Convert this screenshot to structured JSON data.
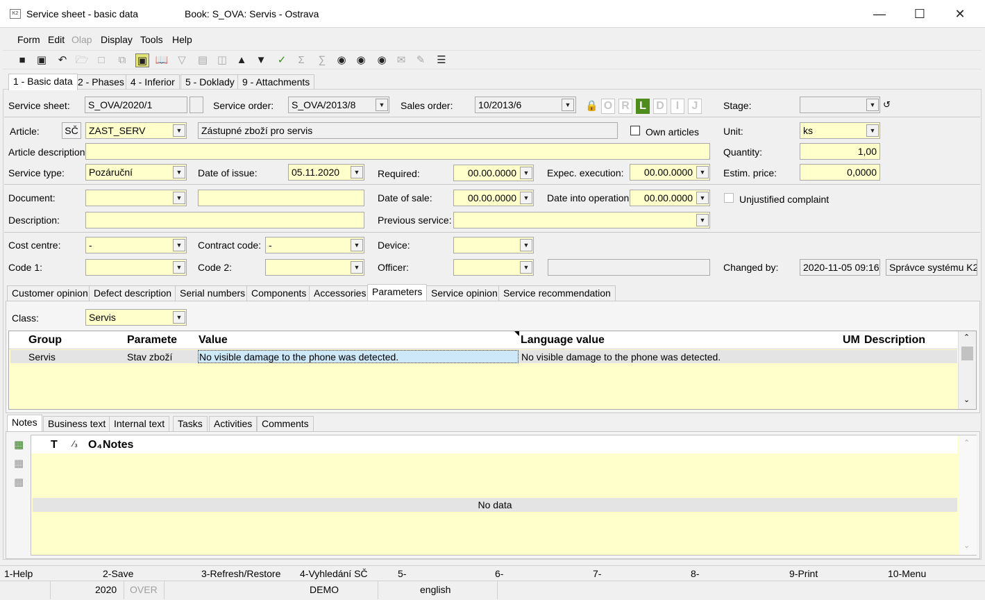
{
  "window": {
    "title": "Service sheet - basic data",
    "book_title": "Book: S_OVA: Servis - Ostrava",
    "app_icon_text": "K2",
    "minimize_glyph": "—",
    "maximize_glyph": "☐",
    "close_glyph": "✕"
  },
  "menu": [
    {
      "label": "Form",
      "enabled": true
    },
    {
      "label": "Edit",
      "enabled": true
    },
    {
      "label": "Olap",
      "enabled": false
    },
    {
      "label": "Display",
      "enabled": true
    },
    {
      "label": "Tools",
      "enabled": true
    },
    {
      "label": "Help",
      "enabled": true
    }
  ],
  "toolbar_icons": [
    "save-icon",
    "save-close-icon",
    "undo-icon",
    "open-folder-icon",
    "new-document-icon",
    "copy-icon",
    "lock-icon",
    "book-icon",
    "filter-icon",
    "filter-list-icon",
    "stack-icon",
    "arrow-up-icon",
    "arrow-down-icon",
    "check-edit-icon",
    "sum-icon",
    "batch-icon",
    "binoculars-icon",
    "binoculars-plus-icon",
    "binoculars-wave-icon",
    "mail-icon",
    "edit-note-icon",
    "hamburger-menu-icon"
  ],
  "main_tabs": [
    "1 - Basic data",
    "2 - Phases",
    "4 - Inferior",
    "5 - Doklady",
    "9 - Attachments"
  ],
  "form": {
    "service_sheet_label": "Service sheet:",
    "service_sheet_value": "S_OVA/2020/1",
    "service_order_label": "Service order:",
    "service_order_value": "S_OVA/2013/8",
    "sales_order_label": "Sales order:",
    "sales_order_value": "10/2013/6",
    "status_letters": [
      "O",
      "R",
      "L",
      "D",
      "I",
      "J"
    ],
    "status_active": "L",
    "stage_label": "Stage:",
    "stage_value": "",
    "article_label": "Article:",
    "article_sc": "SČ",
    "article_value": "ZAST_SERV",
    "article_name": "Zástupné zboží pro servis",
    "own_articles_label": "Own articles",
    "unit_label": "Unit:",
    "unit_value": "ks",
    "article_desc_label": "Article description:",
    "article_desc_value": "",
    "quantity_label": "Quantity:",
    "quantity_value": "1,00",
    "service_type_label": "Service type:",
    "service_type_value": "Pozáruční",
    "date_issue_label": "Date of issue:",
    "date_issue_value": "05.11.2020",
    "required_label": "Required:",
    "required_value": "00.00.0000",
    "expec_exec_label": "Expec. execution:",
    "expec_exec_value": "00.00.0000",
    "estim_price_label": "Estim. price:",
    "estim_price_value": "0,0000",
    "document_label": "Document:",
    "document_value": "",
    "document_text": "",
    "date_sale_label": "Date of sale:",
    "date_sale_value": "00.00.0000",
    "date_operation_label": "Date into operation",
    "date_operation_value": "00.00.0000",
    "unjustified_label": "Unjustified complaint",
    "description_label": "Description:",
    "description_value": "",
    "previous_service_label": "Previous service:",
    "previous_service_value": "",
    "cost_centre_label": "Cost centre:",
    "cost_centre_value": "-",
    "contract_code_label": "Contract code:",
    "contract_code_value": "-",
    "device_label": "Device:",
    "device_value": "",
    "code1_label": "Code 1:",
    "code1_value": "",
    "code2_label": "Code 2:",
    "code2_value": "",
    "officer_label": "Officer:",
    "officer_value": "",
    "officer_text": "",
    "changed_by_label": "Changed by:",
    "changed_by_date": "2020-11-05 09:16",
    "changed_by_user": "Správce systému K2"
  },
  "sub_tabs": [
    "Customer opinion",
    "Defect description",
    "Serial numbers",
    "Components",
    "Accessories",
    "Parameters",
    "Service opinion",
    "Service recommendation"
  ],
  "sub_tab_active": "Parameters",
  "parameters": {
    "class_label": "Class:",
    "class_value": "Servis",
    "columns": [
      "Group",
      "Paramete",
      "Value",
      "Language value",
      "UM",
      "Description"
    ],
    "rows": [
      {
        "group": "Servis",
        "parameter": "Stav zboží",
        "value": "No visible damage to the phone was detected.",
        "language_value": "No visible damage to the phone was detected.",
        "um": "",
        "description": ""
      }
    ]
  },
  "notes_tabs": [
    "Notes",
    "Business text",
    "Internal text",
    "Tasks",
    "Activities",
    "Comments"
  ],
  "notes_tab_active": "Notes",
  "notes_grid": {
    "columns": [
      "T",
      "⁄₃",
      "O₄",
      "Notes"
    ],
    "empty_text": "No data"
  },
  "function_keys": [
    "1-Help",
    "2-Save",
    "3-Refresh/Restore",
    "4-Vyhledání SČ",
    "5-",
    "6-",
    "7-",
    "8-",
    "9-Print",
    "10-Menu"
  ],
  "status_bar": {
    "year": "2020",
    "mode": "OVER",
    "database": "DEMO",
    "language": "english"
  }
}
